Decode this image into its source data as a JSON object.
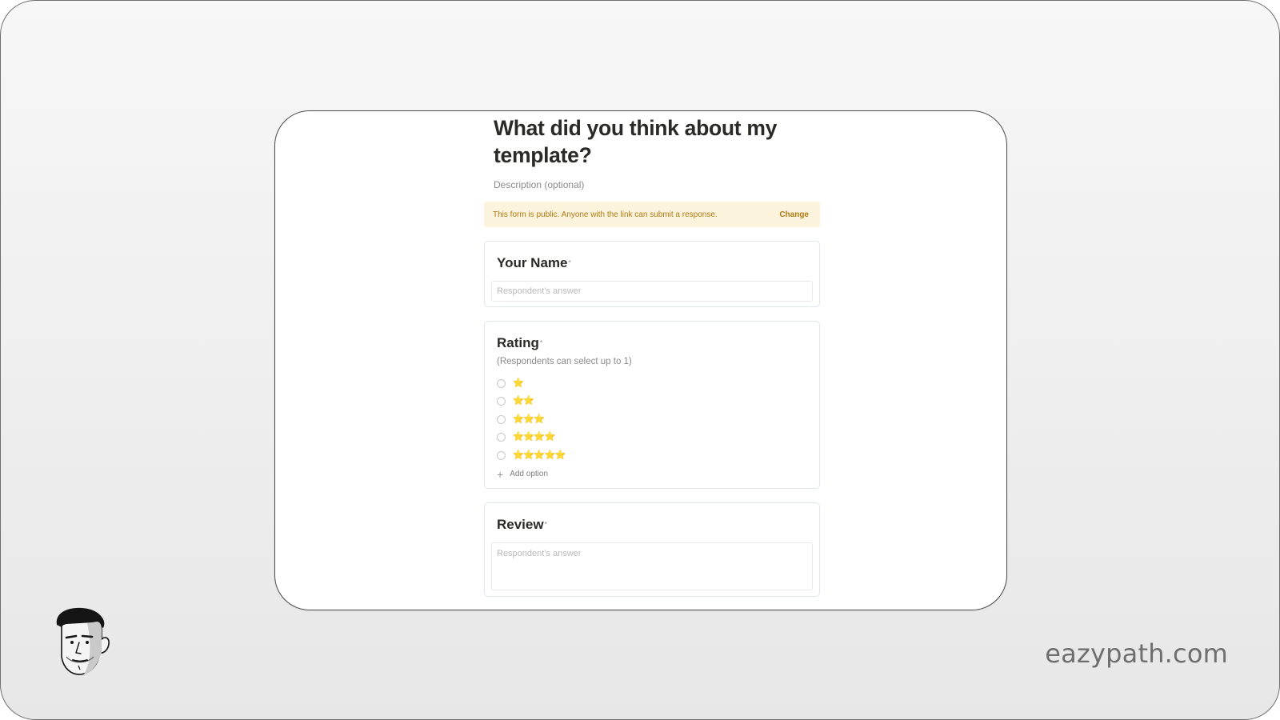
{
  "form": {
    "title": "What did you think about my template?",
    "description": "Description (optional)",
    "notice": {
      "text": "This form is public. Anyone with the link can submit a response.",
      "action": "Change"
    },
    "questions": [
      {
        "title": "Your Name",
        "required_mark": "*",
        "placeholder": "Respondent's answer"
      },
      {
        "title": "Rating",
        "required_mark": "*",
        "subtitle": "(Respondents can select up to 1)",
        "options": [
          "⭐",
          "⭐⭐",
          "⭐⭐⭐",
          "⭐⭐⭐⭐",
          "⭐⭐⭐⭐⭐"
        ],
        "add_option_label": "Add option"
      },
      {
        "title": "Review",
        "required_mark": "*",
        "placeholder": "Respondent's answer"
      }
    ]
  },
  "branding": {
    "site": "eazypath.com"
  },
  "icons": {
    "add": "plus-icon",
    "avatar": "avatar-illustration"
  },
  "colors": {
    "notice_bg": "#fbf3db",
    "notice_text": "#b07a17",
    "card_border": "#e1e5ef",
    "title_text": "#2a2a26"
  }
}
